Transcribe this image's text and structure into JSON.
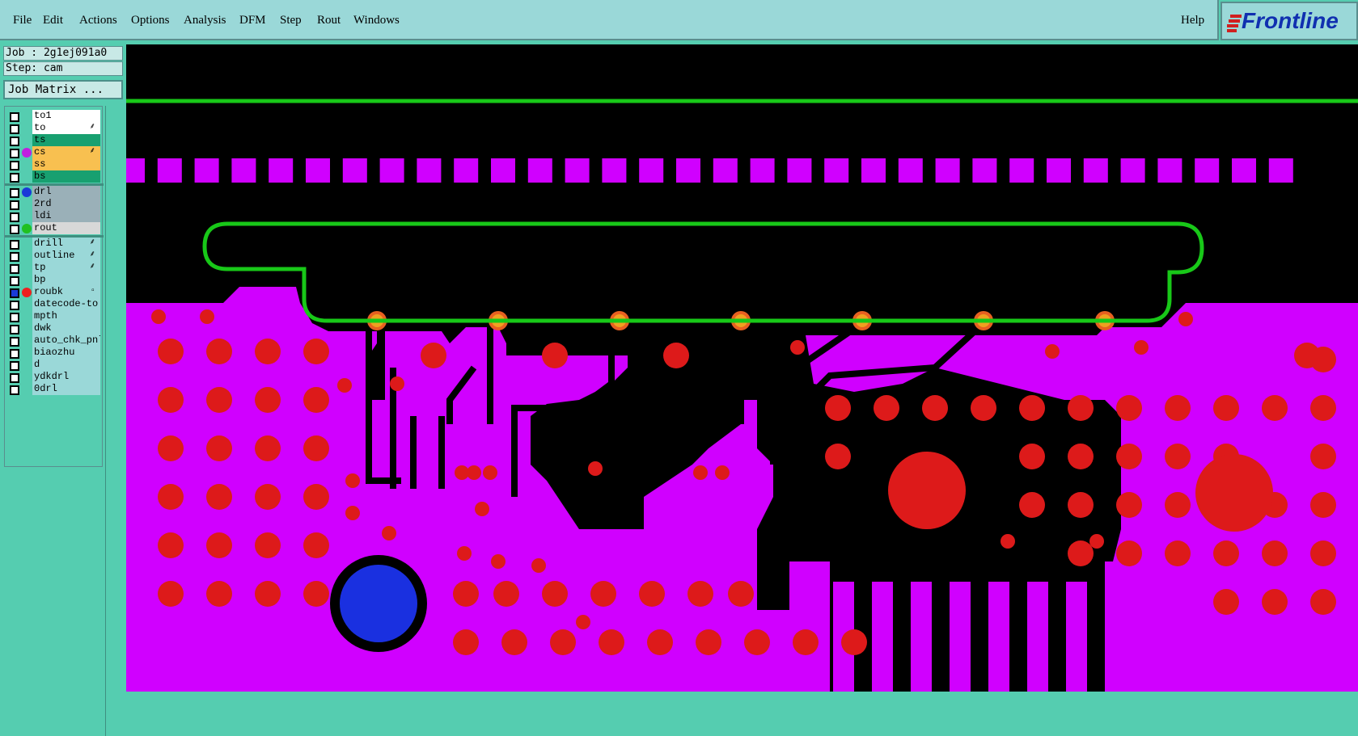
{
  "menubar": {
    "items": [
      "File",
      "Edit",
      "Actions",
      "Options",
      "Analysis",
      "DFM",
      "Step",
      "Rout",
      "Windows"
    ],
    "help": "Help"
  },
  "logo": "Frontline",
  "job_info": {
    "job": "Job : 2g1ej091a0",
    "step": "Step: cam",
    "matrix_button": "Job Matrix ..."
  },
  "layers": [
    {
      "name": "to1"
    },
    {
      "name": "to",
      "flag": "⸙"
    },
    {
      "name": "ts"
    },
    {
      "name": "cs",
      "flag": "⸙",
      "dot": "#c020e0"
    },
    {
      "name": "ss"
    },
    {
      "name": "bs"
    },
    {
      "name": "drl",
      "dot": "#1a3ad8"
    },
    {
      "name": "2rd"
    },
    {
      "name": "ldi"
    },
    {
      "name": "rout",
      "dot": "#20c020"
    },
    {
      "name": "drill",
      "flag": "⸙"
    },
    {
      "name": "outline",
      "flag": "⸙"
    },
    {
      "name": "tp",
      "flag": "⸙"
    },
    {
      "name": "bp"
    },
    {
      "name": "roubk",
      "flag": "▫",
      "dot": "#ee2020"
    },
    {
      "name": "datecode-to"
    },
    {
      "name": "mpth"
    },
    {
      "name": "dwk"
    },
    {
      "name": "auto_chk_pnl"
    },
    {
      "name": "biaozhu"
    },
    {
      "name": "d"
    },
    {
      "name": "ydkdrl"
    },
    {
      "name": "0drl"
    }
  ],
  "colors": {
    "copper": "#d000ff",
    "pad": "#dd1a1a",
    "rout": "#18c818",
    "drill": "#1a30e0",
    "menu_bg": "#9ad8d8",
    "panel_bg": "#55cdb0",
    "layer_white": "#ffffff",
    "layer_green": "#18a070",
    "layer_orange": "#f8c050",
    "layer_grey": "#9ab0b8",
    "layer_cyan": "#9ad8d8",
    "layer_light": "#d8d8d8"
  }
}
